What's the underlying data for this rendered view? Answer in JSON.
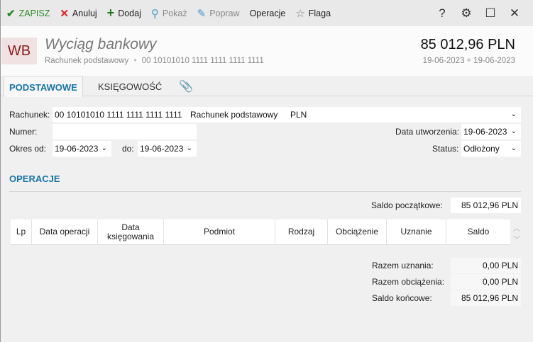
{
  "toolbar": {
    "save": "ZAPISZ",
    "cancel": "Anuluj",
    "add": "Dodaj",
    "show": "Pokaż",
    "edit": "Popraw",
    "operations": "Operacje",
    "flag": "Flaga",
    "help": "?"
  },
  "header": {
    "logo": "WB",
    "title": "Wyciąg bankowy",
    "account_name": "Rachunek podstawowy",
    "separator": "•",
    "account_number": "00 10101010 1111 1111 1111 1111",
    "amount": "85 012,96 PLN",
    "date_range": "19-06-2023 ÷ 19-06-2023"
  },
  "tabs": [
    {
      "label": "PODSTAWOWE"
    },
    {
      "label": "KSIĘGOWOŚĆ"
    }
  ],
  "form": {
    "account_label": "Rachunek:",
    "account_number": "00 10101010 1111 1111 1111 1111",
    "account_name": "Rachunek podstawowy",
    "currency": "PLN",
    "number_label": "Numer:",
    "number_value": "",
    "created_label": "Data utworzenia:",
    "created_value": "19-06-2023",
    "period_from_label": "Okres od:",
    "period_from": "19-06-2023",
    "period_to_label": "do:",
    "period_to": "19-06-2023",
    "status_label": "Status:",
    "status_value": "Odłożony"
  },
  "operations": {
    "heading": "OPERACJE",
    "opening_label": "Saldo początkowe:",
    "opening_value": "85 012,96 PLN",
    "columns": [
      "Lp",
      "Data operacji",
      "Data księgowania",
      "Podmiot",
      "Rodzaj",
      "Obciążenie",
      "Uznanie",
      "Saldo"
    ],
    "credits_label": "Razem uznania:",
    "credits_value": "0,00 PLN",
    "debits_label": "Razem obciążenia:",
    "debits_value": "0,00 PLN",
    "closing_label": "Saldo końcowe:",
    "closing_value": "85 012,96 PLN"
  }
}
